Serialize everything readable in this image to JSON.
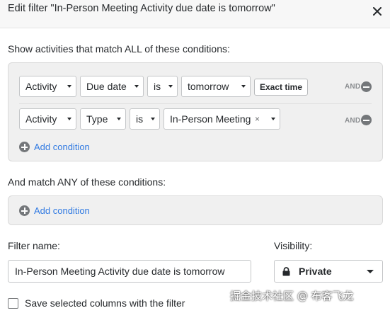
{
  "dialog": {
    "title": "Edit filter \"In-Person Meeting Activity due date is tomorrow\""
  },
  "all_conditions": {
    "label": "Show activities that match ALL of these conditions:",
    "rows": [
      {
        "entity": "Activity",
        "field": "Due date",
        "operator": "is",
        "value": "tomorrow",
        "extra_button": "Exact time",
        "connector": "AND"
      },
      {
        "entity": "Activity",
        "field": "Type",
        "operator": "is",
        "value": "In-Person Meeting",
        "value_clear": "×",
        "connector": "AND"
      }
    ],
    "add_label": "Add condition"
  },
  "any_conditions": {
    "label": "And match ANY of these conditions:",
    "add_label": "Add condition"
  },
  "filter_name": {
    "label": "Filter name:",
    "value": "In-Person Meeting Activity due date is tomorrow"
  },
  "visibility": {
    "label": "Visibility:",
    "value": "Private"
  },
  "save_columns": {
    "label": "Save selected columns with the filter",
    "checked": false
  },
  "watermark": "掘金技术社区 @ 布客飞龙",
  "colors": {
    "link": "#317ae2",
    "panel": "#f0f0f0",
    "header": "#f7f7f7",
    "text": "#26292c"
  },
  "icons": {
    "close": "close-icon",
    "remove": "remove-circle-icon",
    "add": "add-circle-icon",
    "lock": "lock-icon",
    "caret": "caret-down-icon"
  }
}
